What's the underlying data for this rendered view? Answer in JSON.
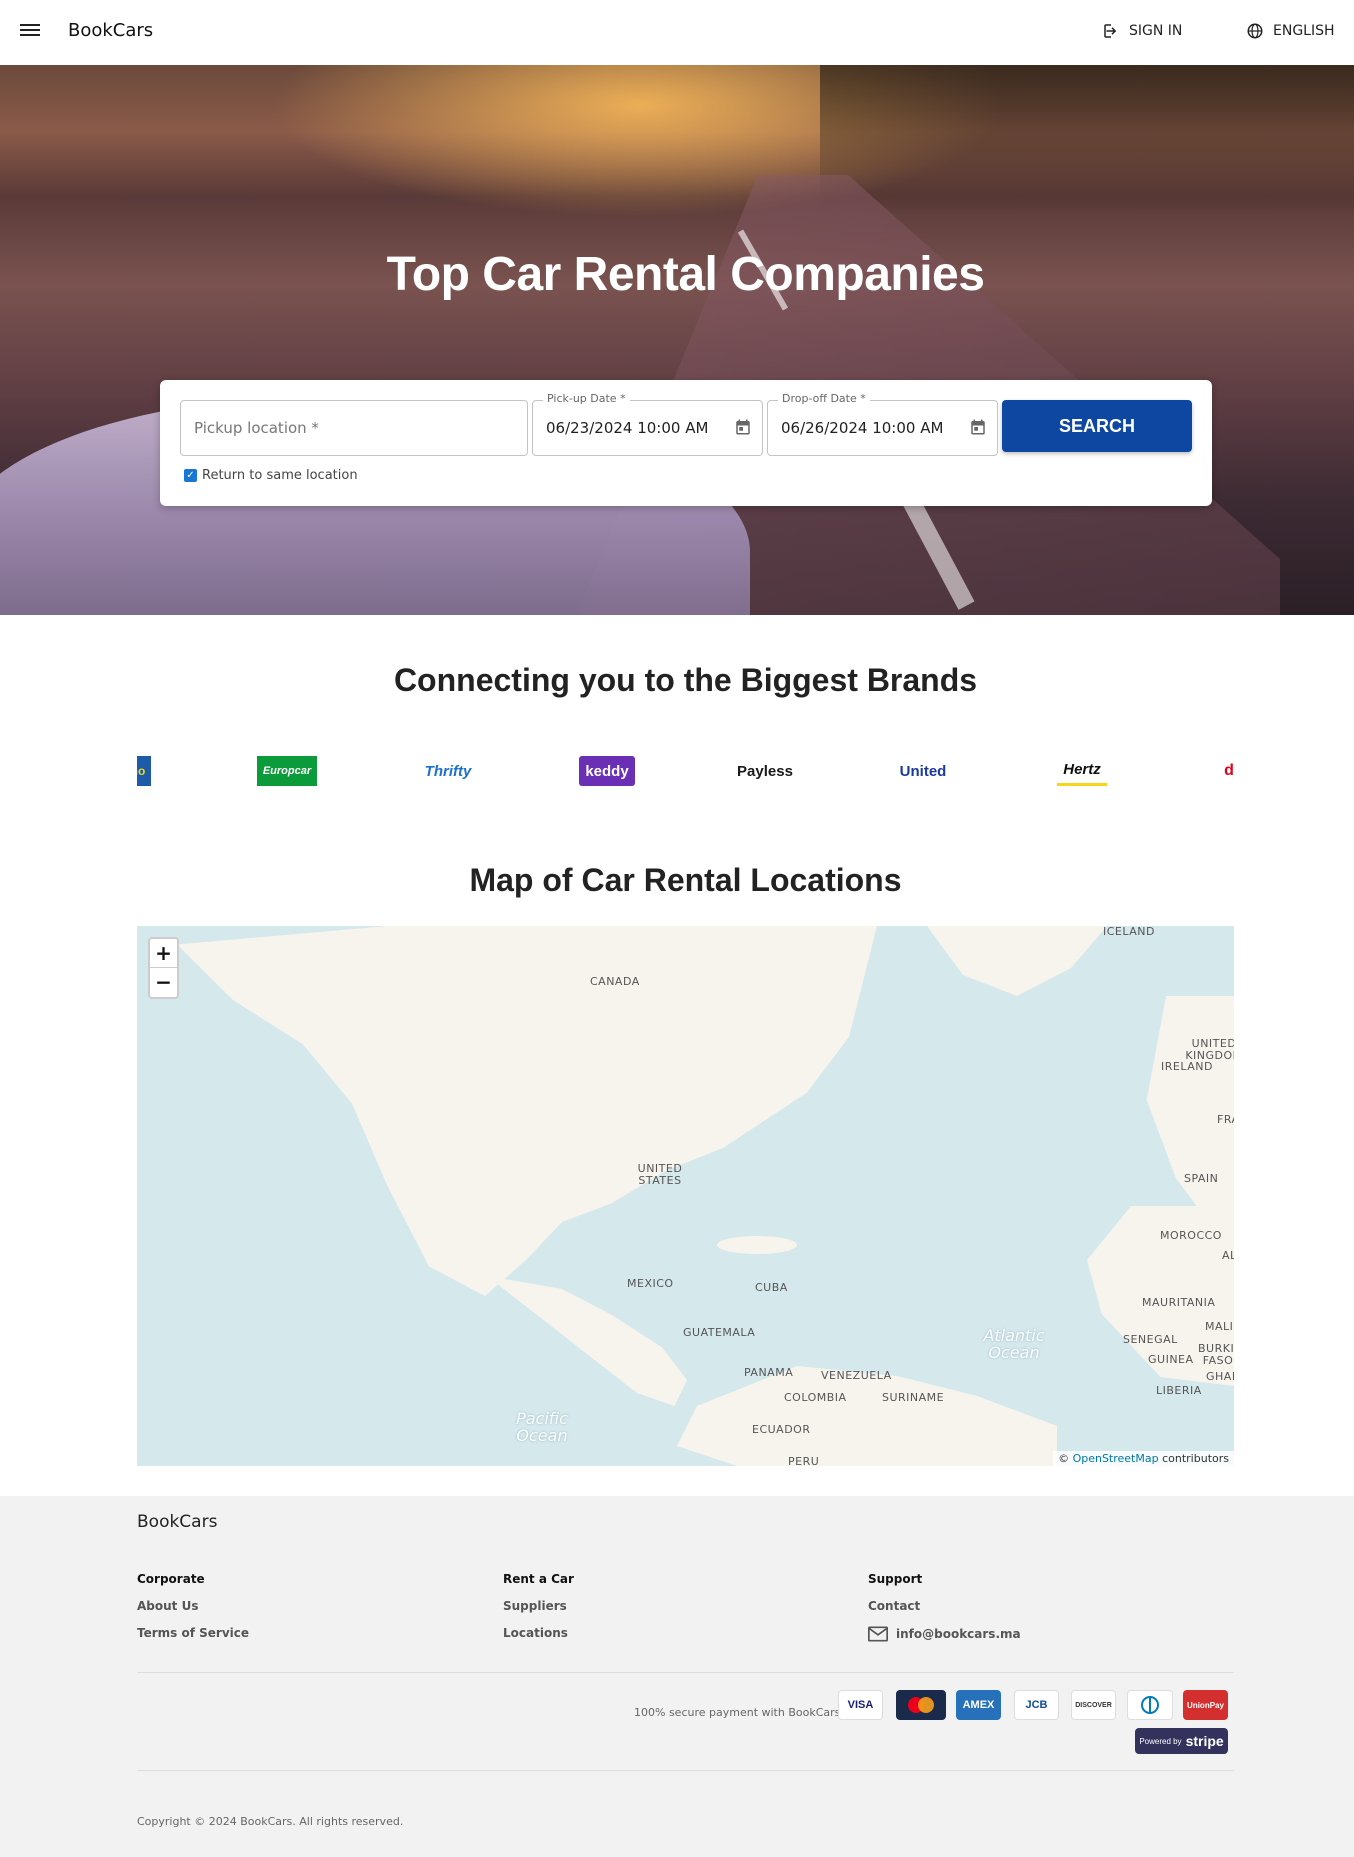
{
  "header": {
    "brand": "BookCars",
    "sign_in": "SIGN IN",
    "language": "ENGLISH"
  },
  "hero": {
    "title": "Top Car Rental Companies",
    "search": {
      "pickup_placeholder": "Pickup location *",
      "pickup_date_label": "Pick-up Date *",
      "pickup_date_value": "06/23/2024 10:00 AM",
      "dropoff_date_label": "Drop-off Date *",
      "dropoff_date_value": "06/26/2024 10:00 AM",
      "search_button": "SEARCH",
      "return_same_location": "Return to same location",
      "return_same_location_checked": true
    }
  },
  "brands": {
    "title": "Connecting you to the Biggest Brands",
    "logos": [
      {
        "name": "no",
        "color": "#f7d618"
      },
      {
        "name": "Europcar",
        "color": "#ffffff"
      },
      {
        "name": "Thrifty",
        "color": "#1b6fcf"
      },
      {
        "name": "keddy",
        "color": "#ffffff"
      },
      {
        "name": "Payless",
        "color": "#1a1a1a"
      },
      {
        "name": "United",
        "color": "#1a3a9c"
      },
      {
        "name": "Hertz",
        "color": "#111111"
      },
      {
        "name": "d",
        "color": "#e2001a"
      }
    ]
  },
  "map": {
    "title": "Map of Car Rental Locations",
    "zoom_in": "+",
    "zoom_out": "−",
    "labels": {
      "iceland": "ICELAND",
      "canada": "CANADA",
      "united_kingdom": "UNITED KINGDOM",
      "ireland": "IRELAND",
      "france": "FRA",
      "spain": "SPAIN",
      "united_states": "UNITED STATES",
      "morocco": "MOROCCO",
      "algeria": "AL",
      "mexico": "MEXICO",
      "cuba": "CUBA",
      "mauritania": "MAURITANIA",
      "mali": "MALI",
      "senegal": "SENEGAL",
      "burkina_faso": "BURKIN FASO",
      "guatemala": "GUATEMALA",
      "guinea": "GUINEA",
      "ghana": "GHAN",
      "panama": "PANAMA",
      "venezuela": "VENEZUELA",
      "liberia": "LIBERIA",
      "colombia": "COLOMBIA",
      "suriname": "SURINAME",
      "ecuador": "ECUADOR",
      "peru": "PERU",
      "atlantic": "Atlantic Ocean",
      "pacific": "Pacific Ocean"
    },
    "attribution_prefix": "©",
    "attribution_link": "OpenStreetMap",
    "attribution_suffix": "contributors"
  },
  "footer": {
    "brand": "BookCars",
    "corporate": {
      "title": "Corporate",
      "links": [
        "About Us",
        "Terms of Service"
      ]
    },
    "rent_a_car": {
      "title": "Rent a Car",
      "links": [
        "Suppliers",
        "Locations"
      ]
    },
    "support": {
      "title": "Support",
      "links": [
        "Contact"
      ],
      "email": "info@bookcars.ma"
    },
    "secure_payment": "100% secure payment with BookCars",
    "cards": [
      "VISA",
      "Mastercard",
      "AMEX",
      "JCB",
      "DISCOVER",
      "Diners",
      "UnionPay"
    ],
    "powered_by": "Powered by",
    "stripe": "stripe",
    "copyright": "Copyright © 2024 BookCars. All rights reserved."
  }
}
